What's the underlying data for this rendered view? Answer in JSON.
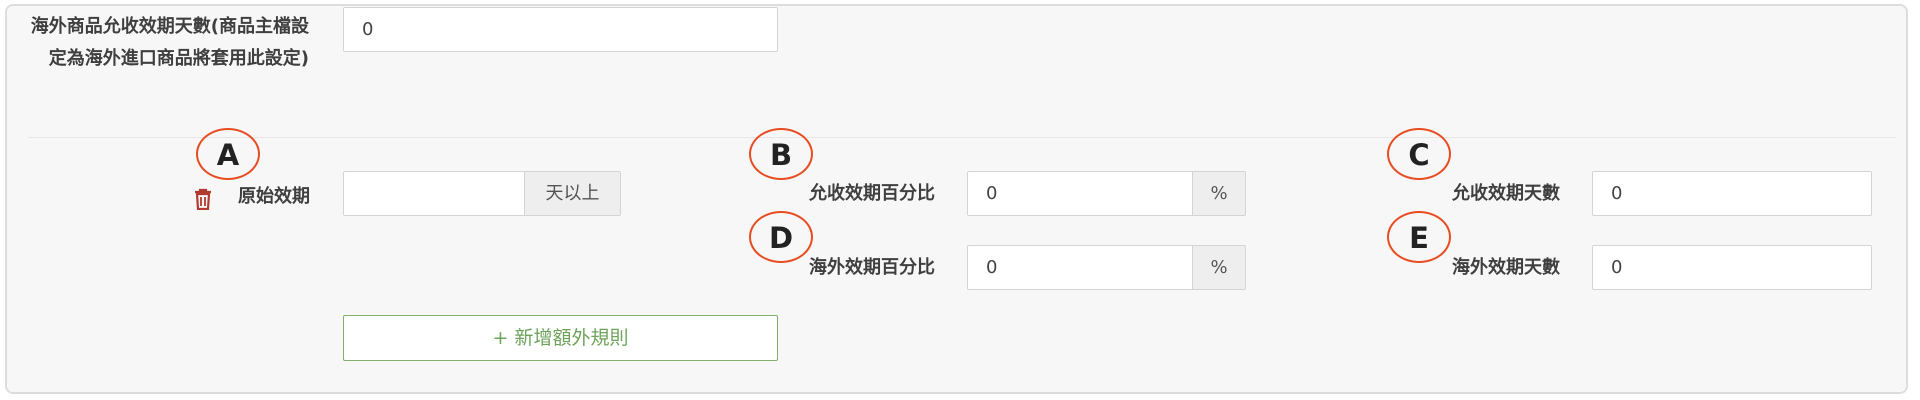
{
  "overseas_days": {
    "label": "海外商品允收效期天數(商品主檔設定為海外進口商品將套用此設定)",
    "value": "0"
  },
  "rule": {
    "original_label": "原始效期",
    "days_value": "",
    "days_suffix": "天以上",
    "accept_percent_label": "允收效期百分比",
    "accept_percent_value": "0",
    "percent_symbol": "%",
    "accept_days_label": "允收效期天數",
    "accept_days_value": "0",
    "overseas_percent_label": "海外效期百分比",
    "overseas_percent_value": "0",
    "overseas_days_label": "海外效期天數",
    "overseas_days_value": "0"
  },
  "add_rule_button": "+ 新增額外規則",
  "markers": {
    "a": "A",
    "b": "B",
    "c": "C",
    "d": "D",
    "e": "E"
  },
  "icons": {
    "delete": "trash-icon"
  },
  "colors": {
    "delete_icon": "#b33a2f",
    "marker_outline": "#e84d22",
    "add_button": "#6da35b"
  }
}
